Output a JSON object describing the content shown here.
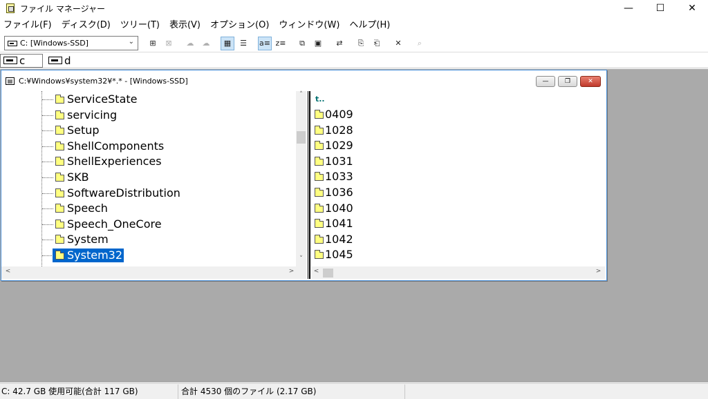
{
  "window": {
    "title": "ファイル マネージャー",
    "controls": {
      "minimize": "—",
      "maximize": "☐",
      "close": "✕"
    }
  },
  "menu": [
    "ファイル(F)",
    "ディスク(D)",
    "ツリー(T)",
    "表示(V)",
    "オプション(O)",
    "ウィンドウ(W)",
    "ヘルプ(H)"
  ],
  "toolbar": {
    "drive_select": {
      "value": "C: [Windows-SSD]",
      "icon": "hard-drive-icon"
    },
    "buttons": [
      {
        "name": "connect-drive-icon",
        "glyph": "⊞"
      },
      {
        "name": "disconnect-drive-icon",
        "glyph": "⊠",
        "dim": true
      },
      {
        "name": "share-icon",
        "glyph": "☁",
        "dim": true
      },
      {
        "name": "stop-share-icon",
        "glyph": "☁",
        "dim": true
      },
      {
        "name": "large-icons-view-icon",
        "glyph": "▦",
        "pressed": true
      },
      {
        "name": "list-view-icon",
        "glyph": "☰"
      },
      {
        "name": "sort-by-name-icon",
        "glyph": "a≡",
        "pressed": true
      },
      {
        "name": "sort-by-type-icon",
        "glyph": "z≡"
      },
      {
        "name": "new-window-icon",
        "glyph": "⧉"
      },
      {
        "name": "properties-icon",
        "glyph": "▣"
      },
      {
        "name": "move-icon",
        "glyph": "⇄"
      },
      {
        "name": "copy-icon",
        "glyph": "⎘"
      },
      {
        "name": "paste-icon",
        "glyph": "⎗"
      },
      {
        "name": "delete-icon",
        "glyph": "✕"
      },
      {
        "name": "search-icon",
        "glyph": "⌕",
        "dim": true
      }
    ]
  },
  "drives": [
    {
      "letter": "c",
      "active": true
    },
    {
      "letter": "d",
      "active": false
    }
  ],
  "child_window": {
    "title": "C:¥Windows¥system32¥*.* - [Windows-SSD]",
    "controls": {
      "minimize": "—",
      "restore": "❐",
      "close": "✕"
    }
  },
  "tree": [
    {
      "label": "ServiceState"
    },
    {
      "label": "servicing"
    },
    {
      "label": "Setup"
    },
    {
      "label": "ShellComponents"
    },
    {
      "label": "ShellExperiences"
    },
    {
      "label": "SKB"
    },
    {
      "label": "SoftwareDistribution"
    },
    {
      "label": "Speech"
    },
    {
      "label": "Speech_OneCore"
    },
    {
      "label": "System"
    },
    {
      "label": "System32",
      "selected": true
    }
  ],
  "files": {
    "updir": "t..",
    "items": [
      "0409",
      "1028",
      "1029",
      "1031",
      "1033",
      "1036",
      "1040",
      "1041",
      "1042",
      "1045"
    ]
  },
  "status": {
    "left": "C: 42.7 GB 使用可能(合計 117 GB)",
    "right": "合計 4530 個のファイル (2.17 GB)"
  },
  "scroll": {
    "up": "˄",
    "down": "˅",
    "left": "<",
    "right": ">"
  }
}
